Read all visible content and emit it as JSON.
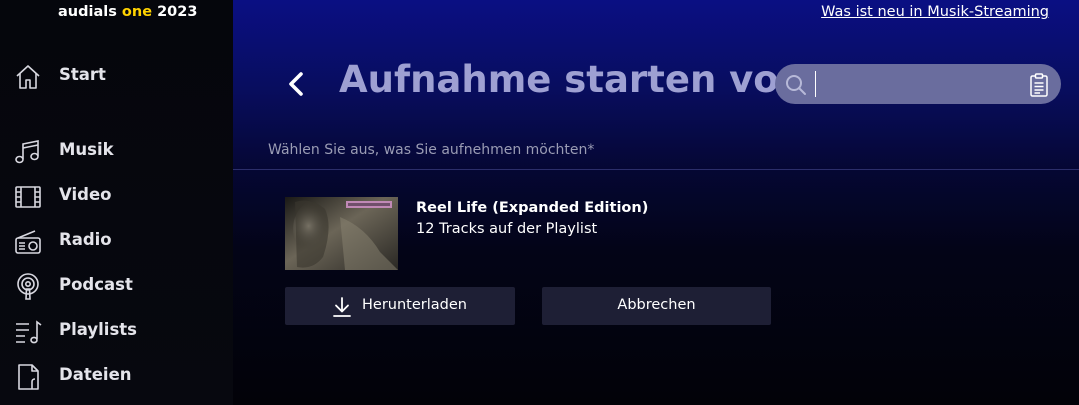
{
  "brand": {
    "name": "audials",
    "edition": "one",
    "year": "2023",
    "accent_color": "#ffd200"
  },
  "sidebar": {
    "items": [
      {
        "label": "Start",
        "icon": "home-icon"
      },
      {
        "label": "Musik",
        "icon": "music-note-icon"
      },
      {
        "label": "Video",
        "icon": "film-icon"
      },
      {
        "label": "Radio",
        "icon": "radio-icon"
      },
      {
        "label": "Podcast",
        "icon": "podcast-icon"
      },
      {
        "label": "Playlists",
        "icon": "playlist-icon"
      },
      {
        "label": "Dateien",
        "icon": "file-icon"
      }
    ]
  },
  "header": {
    "whats_new_link": "Was ist neu in Musik-Streaming",
    "title": "Aufnahme starten von",
    "search": {
      "value": "",
      "placeholder": ""
    }
  },
  "main": {
    "subtitle": "Wählen Sie aus, was Sie aufnehmen möchten*",
    "album": {
      "title": "Reel Life (Expanded Edition)",
      "track_info": "12 Tracks auf der Playlist"
    },
    "buttons": {
      "download_label": "Herunterladen",
      "cancel_label": "Abbrechen"
    }
  },
  "colors": {
    "title": "#9ea0d2",
    "search_bg": "#6a6d9e",
    "button_bg": "#1e1f35",
    "main_top": "#0a0f83"
  }
}
